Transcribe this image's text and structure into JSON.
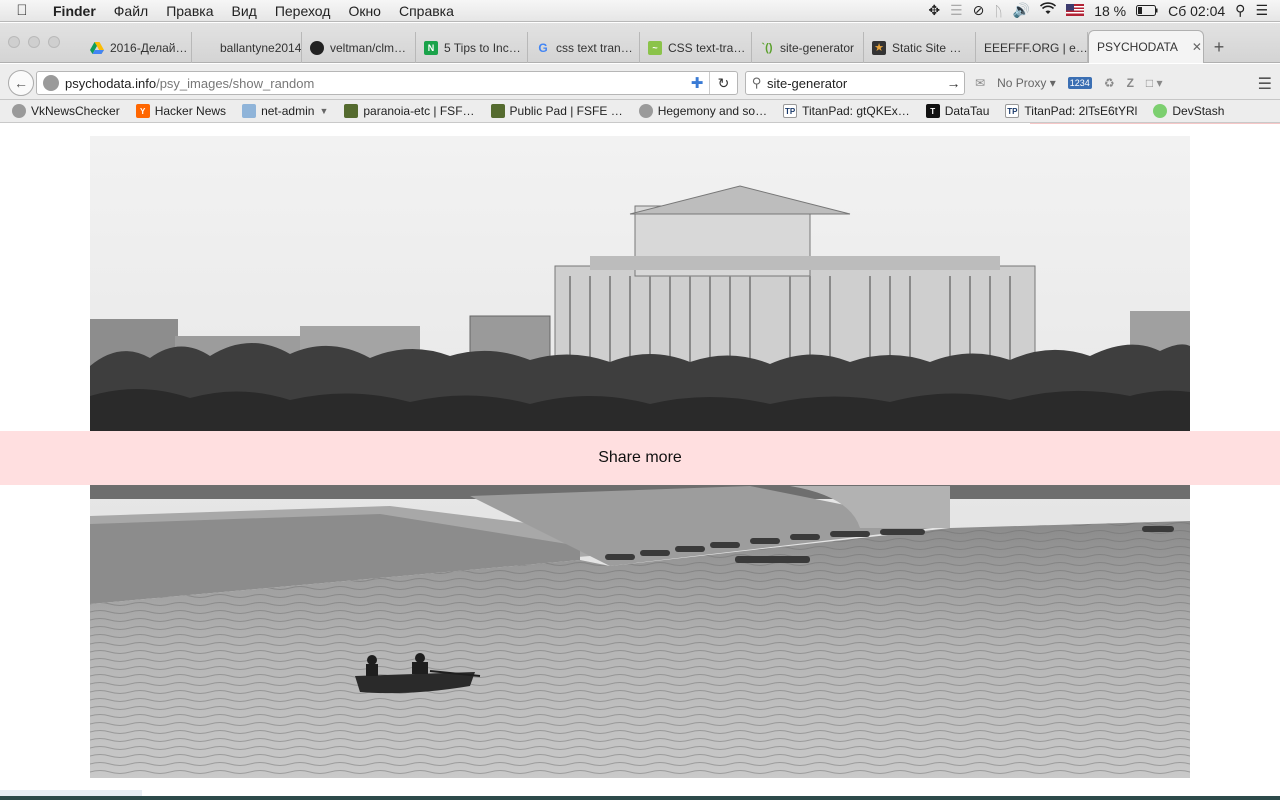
{
  "menubar": {
    "app": "Finder",
    "items": [
      "Файл",
      "Правка",
      "Вид",
      "Переход",
      "Окно",
      "Справка"
    ],
    "battery": "18 %",
    "clock": "Сб 02:04"
  },
  "tabs": [
    {
      "title": "2016-Делай…",
      "icon": "google-drive-icon"
    },
    {
      "title": "ballantyne2014…",
      "icon": "page-icon"
    },
    {
      "title": "veltman/clm…",
      "icon": "github-icon"
    },
    {
      "title": "5 Tips to Inc…",
      "icon": "n-icon"
    },
    {
      "title": "css text tran…",
      "icon": "google-icon"
    },
    {
      "title": "CSS text-tra…",
      "icon": "css-icon"
    },
    {
      "title": "site-generator",
      "icon": "brackets-icon"
    },
    {
      "title": "Static Site …",
      "icon": "star-icon"
    },
    {
      "title": "EEEFFF.ORG | e…",
      "icon": "page-icon"
    },
    {
      "title": "PSYCHODATA",
      "icon": "page-icon",
      "active": true
    }
  ],
  "nav": {
    "url_host": "psychodata.info",
    "url_path": "/psy_images/show_random",
    "search_value": "site-generator",
    "proxy_label": "No Proxy",
    "counter_badge": "1234"
  },
  "bookmarks": [
    {
      "label": "VkNewsChecker",
      "icon": "globe-icon"
    },
    {
      "label": "Hacker News",
      "icon": "y-icon"
    },
    {
      "label": "net-admin",
      "icon": "folder-icon"
    },
    {
      "label": "paranoia-etc | FSF…",
      "icon": "pad-icon"
    },
    {
      "label": "Public Pad | FSFE …",
      "icon": "pad-icon"
    },
    {
      "label": "Hegemony and so…",
      "icon": "globe-icon"
    },
    {
      "label": "TitanPad: gtQKEx…",
      "icon": "tp-icon"
    },
    {
      "label": "DataTau",
      "icon": "t-icon"
    },
    {
      "label": "TitanPad: 2lTsE6tYRl",
      "icon": "tp-icon"
    },
    {
      "label": "DevStash",
      "icon": "leaf-icon"
    }
  ],
  "page": {
    "share_label": "Share more"
  }
}
